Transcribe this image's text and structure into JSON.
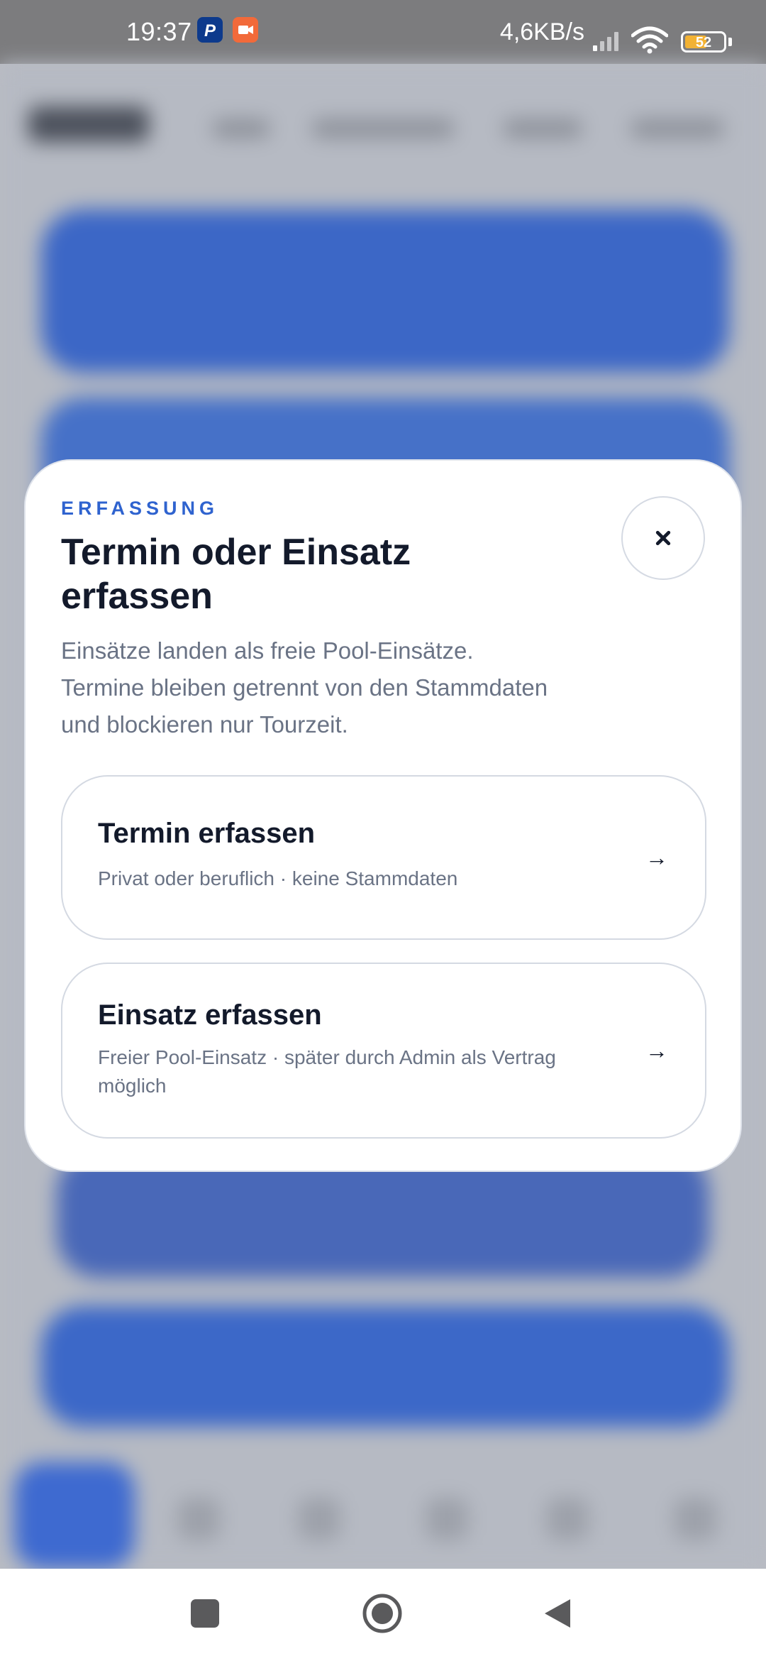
{
  "status_bar": {
    "time": "19:37",
    "network_speed": "4,6KB/s",
    "battery_level": "52",
    "notification_icons": [
      "paypal-icon",
      "video-recorder-icon"
    ],
    "status_icons": [
      "signal-icon",
      "wifi-icon",
      "battery-icon"
    ],
    "colors": {
      "paypal": "#0d3a8c",
      "video": "#f26a3a",
      "battery_fill": "#f3b233"
    }
  },
  "sheet": {
    "eyebrow": "ERFASSUNG",
    "title": "Termin oder Einsatz erfassen",
    "subtitle_lines": [
      "Einsätze landen als freie Pool-Einsätze.",
      "Termine bleiben getrennt von den Stammdaten",
      "und blockieren nur Tourzeit."
    ],
    "close_icon": "close-icon",
    "options": [
      {
        "title": "Termin erfassen",
        "description": "Privat oder beruflich · keine Stammdaten",
        "arrow": "→"
      },
      {
        "title": "Einsatz erfassen",
        "description": "Freier Pool-Einsatz · später durch Admin als Vertrag möglich",
        "arrow": "→"
      }
    ]
  },
  "nav_bar": {
    "buttons": [
      "recents-square-icon",
      "home-circle-icon",
      "back-triangle-icon"
    ]
  },
  "colors": {
    "accent": "#2f63cf",
    "title": "#131a2b",
    "muted_text": "#6a7385",
    "backdrop": "#b9bcc3"
  }
}
